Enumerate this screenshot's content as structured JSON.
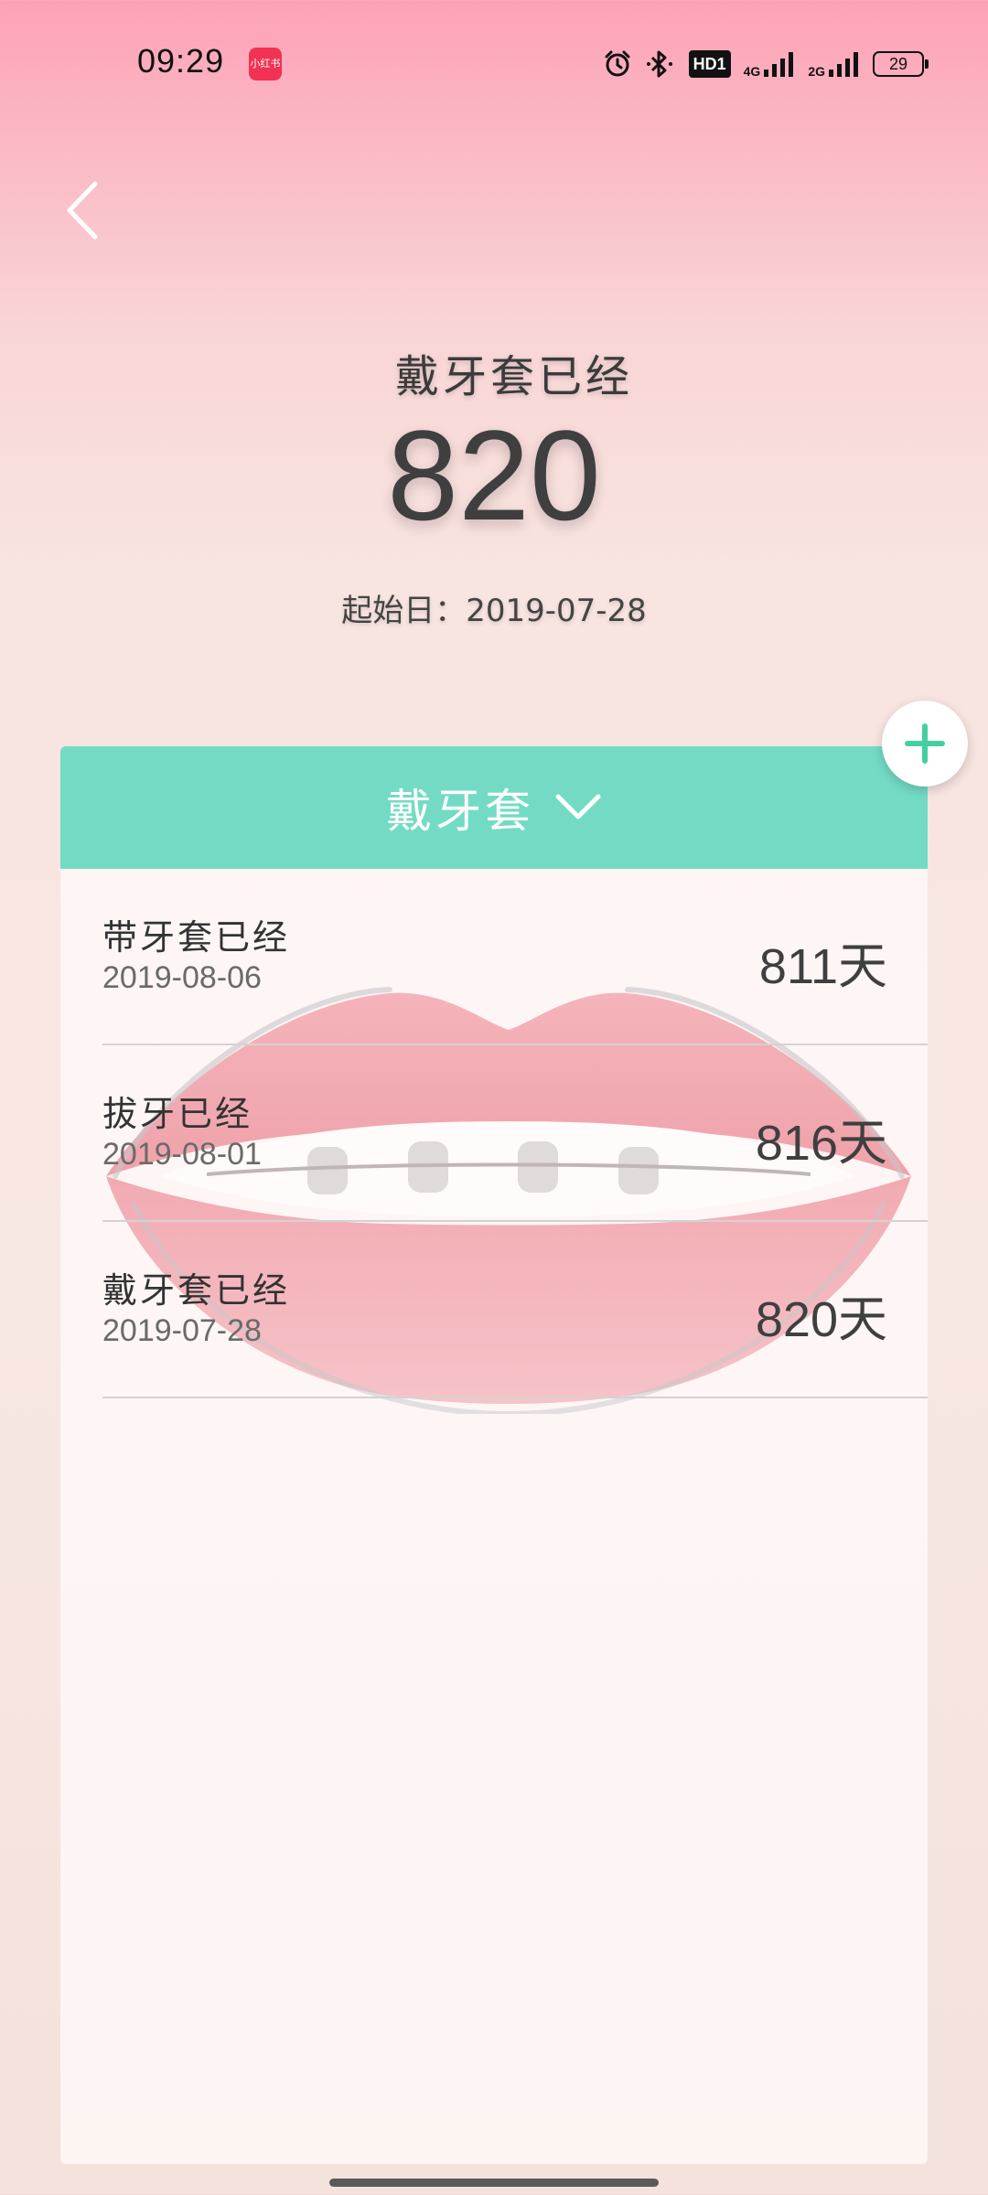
{
  "status_bar": {
    "time": "09:29",
    "notification_app": "小红书",
    "icons": [
      "alarm-icon",
      "bluetooth-icon",
      "hd-icon",
      "signal-4g-icon",
      "signal-2g-icon",
      "battery-icon"
    ],
    "hd_label": "HD1",
    "signal_1_label": "4G",
    "signal_2_label": "2G",
    "battery_level": "29"
  },
  "header": {
    "title": "戴牙套已经",
    "day_count": "820",
    "start_date_label": "起始日：",
    "start_date_value": "2019-07-28"
  },
  "card": {
    "title": "戴牙套",
    "accent_color": "#73dbc4",
    "records": [
      {
        "title": "带牙套已经",
        "date": "2019-08-06",
        "days": "811天"
      },
      {
        "title": "拔牙已经",
        "date": "2019-08-01",
        "days": "816天"
      },
      {
        "title": "戴牙套已经",
        "date": "2019-07-28",
        "days": "820天"
      }
    ]
  },
  "actions": {
    "back_icon": "chevron-left-icon",
    "add_icon": "plus-icon"
  }
}
